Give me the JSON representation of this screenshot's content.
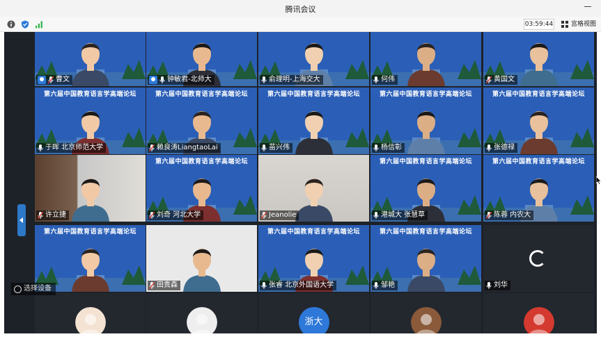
{
  "window": {
    "title": "腾讯会议"
  },
  "toolbar": {
    "timer": "03:59:44",
    "view_label": "宫格视图"
  },
  "banner_text": "第六届中国教育语言学高端论坛",
  "participants": [
    {
      "name": "曹文",
      "host": true,
      "muted": true,
      "style": "banner"
    },
    {
      "name": "钟敏君-北师大",
      "host": true,
      "muted": false,
      "style": "banner"
    },
    {
      "name": "俞理明-上海交大",
      "host": false,
      "muted": false,
      "style": "banner"
    },
    {
      "name": "何伟",
      "host": false,
      "muted": false,
      "style": "banner"
    },
    {
      "name": "黄国文",
      "host": false,
      "muted": true,
      "style": "banner"
    },
    {
      "name": "于晖 北京师范大学",
      "host": false,
      "muted": false,
      "style": "banner"
    },
    {
      "name": "赖良涛LiangtaoLai",
      "host": false,
      "muted": true,
      "style": "banner"
    },
    {
      "name": "苗兴伟",
      "host": false,
      "muted": false,
      "style": "banner"
    },
    {
      "name": "杨信彰",
      "host": false,
      "muted": false,
      "style": "banner"
    },
    {
      "name": "张德禄",
      "host": false,
      "muted": false,
      "style": "banner"
    },
    {
      "name": "许立捷",
      "host": false,
      "muted": true,
      "style": "room"
    },
    {
      "name": "刘奇 河北大学",
      "host": false,
      "muted": true,
      "style": "banner"
    },
    {
      "name": "Jeanolie",
      "host": false,
      "muted": true,
      "style": "wall"
    },
    {
      "name": "港城大 张慧草",
      "host": false,
      "muted": false,
      "style": "banner"
    },
    {
      "name": "陈蓉 内农大",
      "host": false,
      "muted": true,
      "style": "banner"
    },
    {
      "name": "",
      "host": false,
      "muted": false,
      "style": "banner"
    },
    {
      "name": "田贵森",
      "host": false,
      "muted": true,
      "style": "studio"
    },
    {
      "name": "张睿 北京外国语大学",
      "host": false,
      "muted": false,
      "style": "banner"
    },
    {
      "name": "邹艳",
      "host": false,
      "muted": false,
      "style": "banner"
    },
    {
      "name": "刘华",
      "host": false,
      "muted": false,
      "style": "plain",
      "loading": true
    }
  ],
  "bottom_row": [
    {
      "type": "avatar-girl"
    },
    {
      "type": "avatar-dog"
    },
    {
      "type": "text",
      "text": "浙大"
    },
    {
      "type": "avatar-photo"
    },
    {
      "type": "avatar-red"
    }
  ],
  "camera_label": "选择设备",
  "colors": {
    "banner_blue": "#2b5fb7",
    "host_blue": "#2d7bdc",
    "side_tab": "#2d78c8"
  }
}
